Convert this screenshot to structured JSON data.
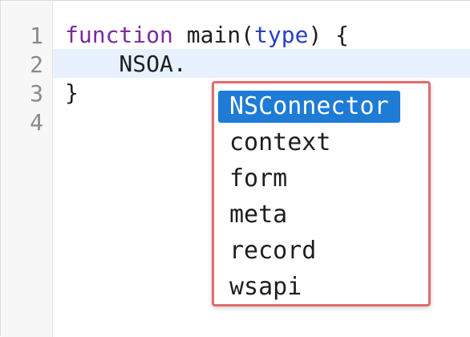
{
  "editor": {
    "line_numbers": [
      "1",
      "2",
      "3",
      "4"
    ],
    "lines": {
      "line1": {
        "keyword": "function",
        "name": " main(",
        "param": "type",
        "rest": ") {"
      },
      "line2": {
        "text": "    NSOA."
      },
      "line3": {
        "text": "}"
      }
    }
  },
  "autocomplete": {
    "items": [
      "NSConnector",
      "context",
      "form",
      "meta",
      "record",
      "wsapi"
    ],
    "selected_index": 0
  },
  "colors": {
    "selection": "#1e7bd6",
    "popup_border": "#e06c6c",
    "keyword": "#7b2aa1",
    "parameter": "#2a3fc2",
    "current_line": "#e8f2fe"
  }
}
